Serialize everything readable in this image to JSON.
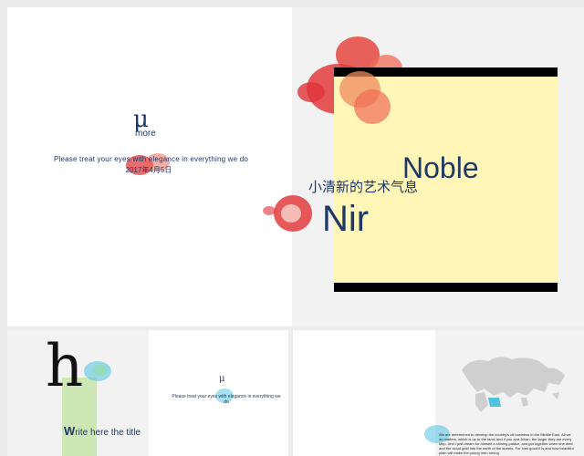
{
  "main_slide": {
    "logo_glyph": "μ",
    "logo_text": "more",
    "tagline": "Please treat your eyes with elegance  in everything  we do",
    "date": "2017年4月5日",
    "subtitle_cn": "小清新的艺术气息",
    "title_line1": "Noble",
    "title_line2": "Nir"
  },
  "thumb_1": {
    "big_glyph": "h",
    "title_prefix": "W",
    "title_rest": "rite here the title",
    "small_mark": "μ",
    "tagline": "Please treat your eyes with elegance in everything  we do"
  },
  "thumb_2": {
    "body_text": "We are determined to develop the country's oil business in the Middle East. All we do matters, which is up to the land, and if you and Julian, the larger they are every step. And I just dream for himself a shining palace, and got together when she died and the cloud gold into the earth of the streets. For how good it is and how beautiful plain will make the young men strong"
  },
  "colors": {
    "navy": "#1f3864",
    "yellow": "#fff6b8",
    "red_ink": "#e0343a",
    "green": "#cde8b4",
    "cyan_ink": "#4fc3e0"
  }
}
